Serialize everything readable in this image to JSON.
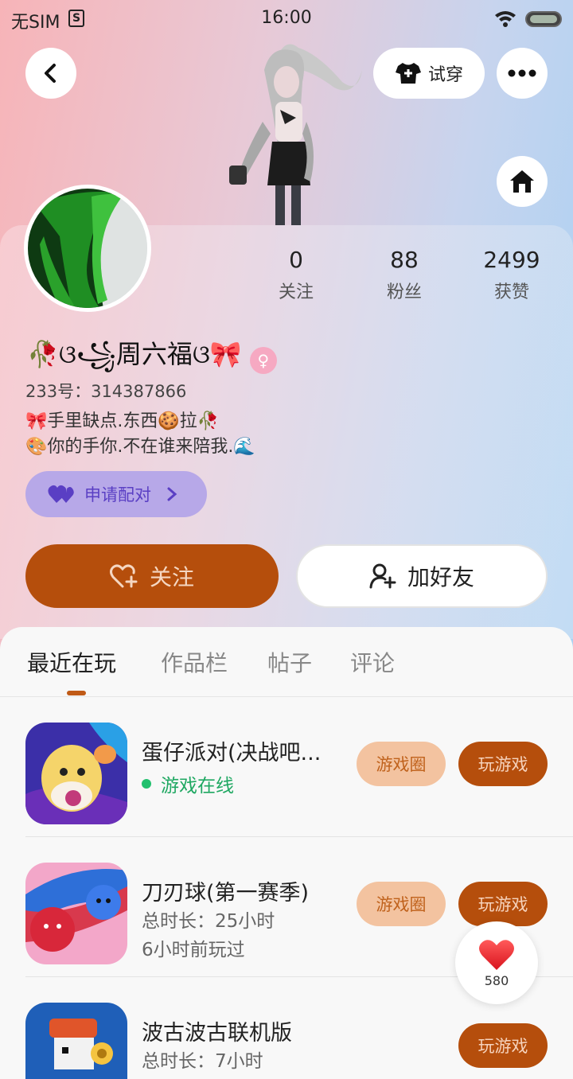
{
  "status_bar": {
    "carrier": "无SIM",
    "sim_badge": "S",
    "time": "16:00"
  },
  "header": {
    "try_on_label": "试穿"
  },
  "profile": {
    "stats": [
      {
        "value": "0",
        "label": "关注"
      },
      {
        "value": "88",
        "label": "粉丝"
      },
      {
        "value": "2499",
        "label": "获赞"
      }
    ],
    "nickname": "🥀ଓ꧁周六福ଓ🎀",
    "gender_symbol": "♀",
    "uid": "233号：314387866",
    "bio_line1": "🎀手里缺点.东西🍪拉🥀",
    "bio_line2": "🎨你的手你.不在谁来陪我.🌊",
    "pair_label": "申请配对",
    "follow_label": "关注",
    "add_friend_label": "加好友"
  },
  "tabs": [
    {
      "label": "最近在玩",
      "active": true
    },
    {
      "label": "作品栏",
      "active": false
    },
    {
      "label": "帖子",
      "active": false
    },
    {
      "label": "评论",
      "active": false
    }
  ],
  "games": [
    {
      "title": "蛋仔派对(决战吧...",
      "line1": "游戏在线",
      "line2": "",
      "circle": "游戏圈",
      "play": "玩游戏"
    },
    {
      "title": "刀刃球(第一赛季)",
      "line1": "总时长：25小时",
      "line2": "6小时前玩过",
      "circle": "游戏圈",
      "play": "玩游戏"
    },
    {
      "title": "波古波古联机版",
      "line1": "总时长：7小时",
      "line2": "",
      "circle": "",
      "play": "玩游戏"
    }
  ],
  "like_count": "580",
  "colors": {
    "accent": "#b54e0c",
    "pair": "#b7a8e8",
    "online": "#1fa862"
  }
}
